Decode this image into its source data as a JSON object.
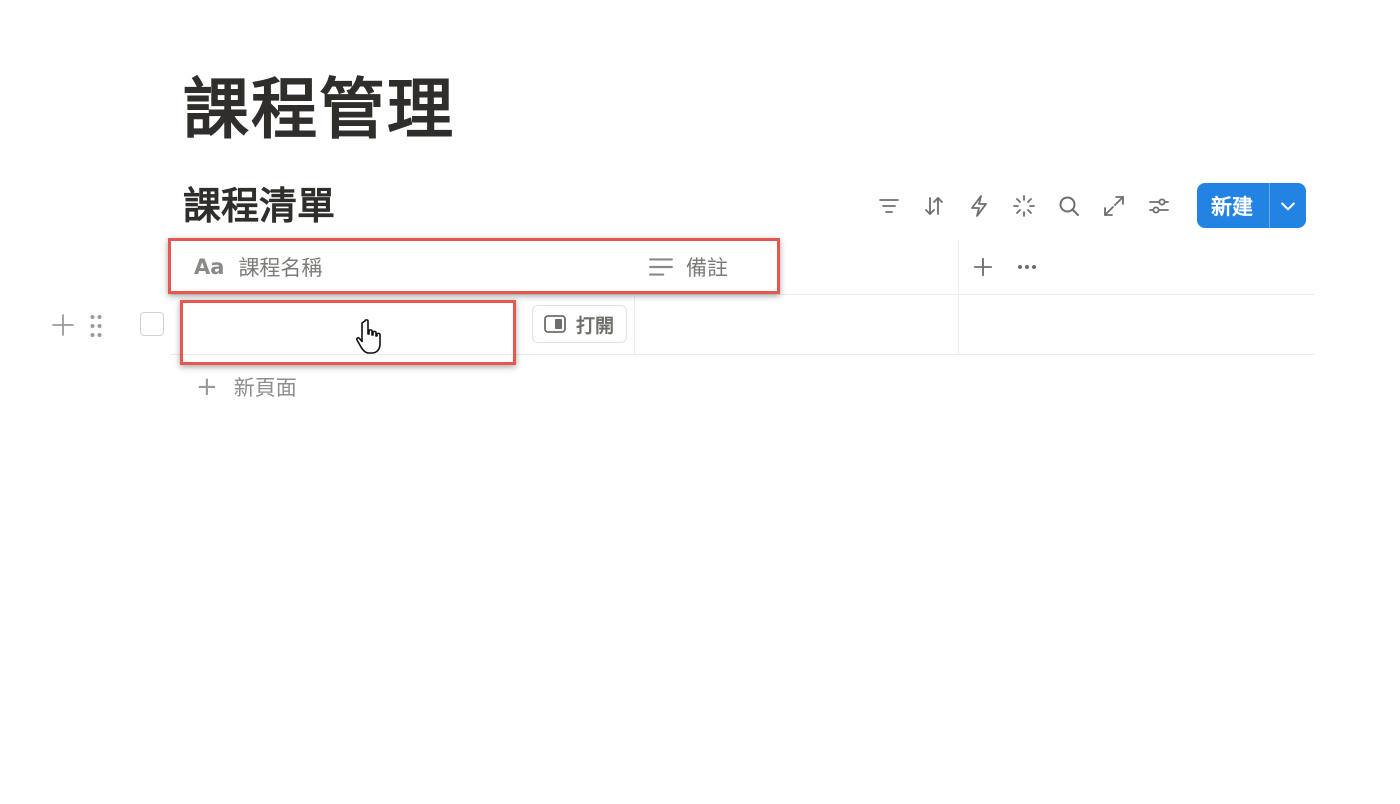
{
  "page": {
    "title": "課程管理"
  },
  "database": {
    "title": "課程清單",
    "toolbar": {
      "icons": [
        "filter-icon",
        "sort-icon",
        "automation-icon",
        "ai-sparkle-icon",
        "search-icon",
        "expand-icon",
        "settings-icon"
      ],
      "new_label": "新建",
      "accent": "#2383e2"
    },
    "columns": [
      {
        "icon": "Aa",
        "label": "課程名稱"
      },
      {
        "icon": "text-lines-icon",
        "label": "備註"
      }
    ],
    "rows": [
      {
        "name": "",
        "open_label": "打開",
        "notes": ""
      }
    ],
    "new_page_label": "新頁面"
  },
  "annotations": {
    "highlight_color": "#e5584f"
  }
}
